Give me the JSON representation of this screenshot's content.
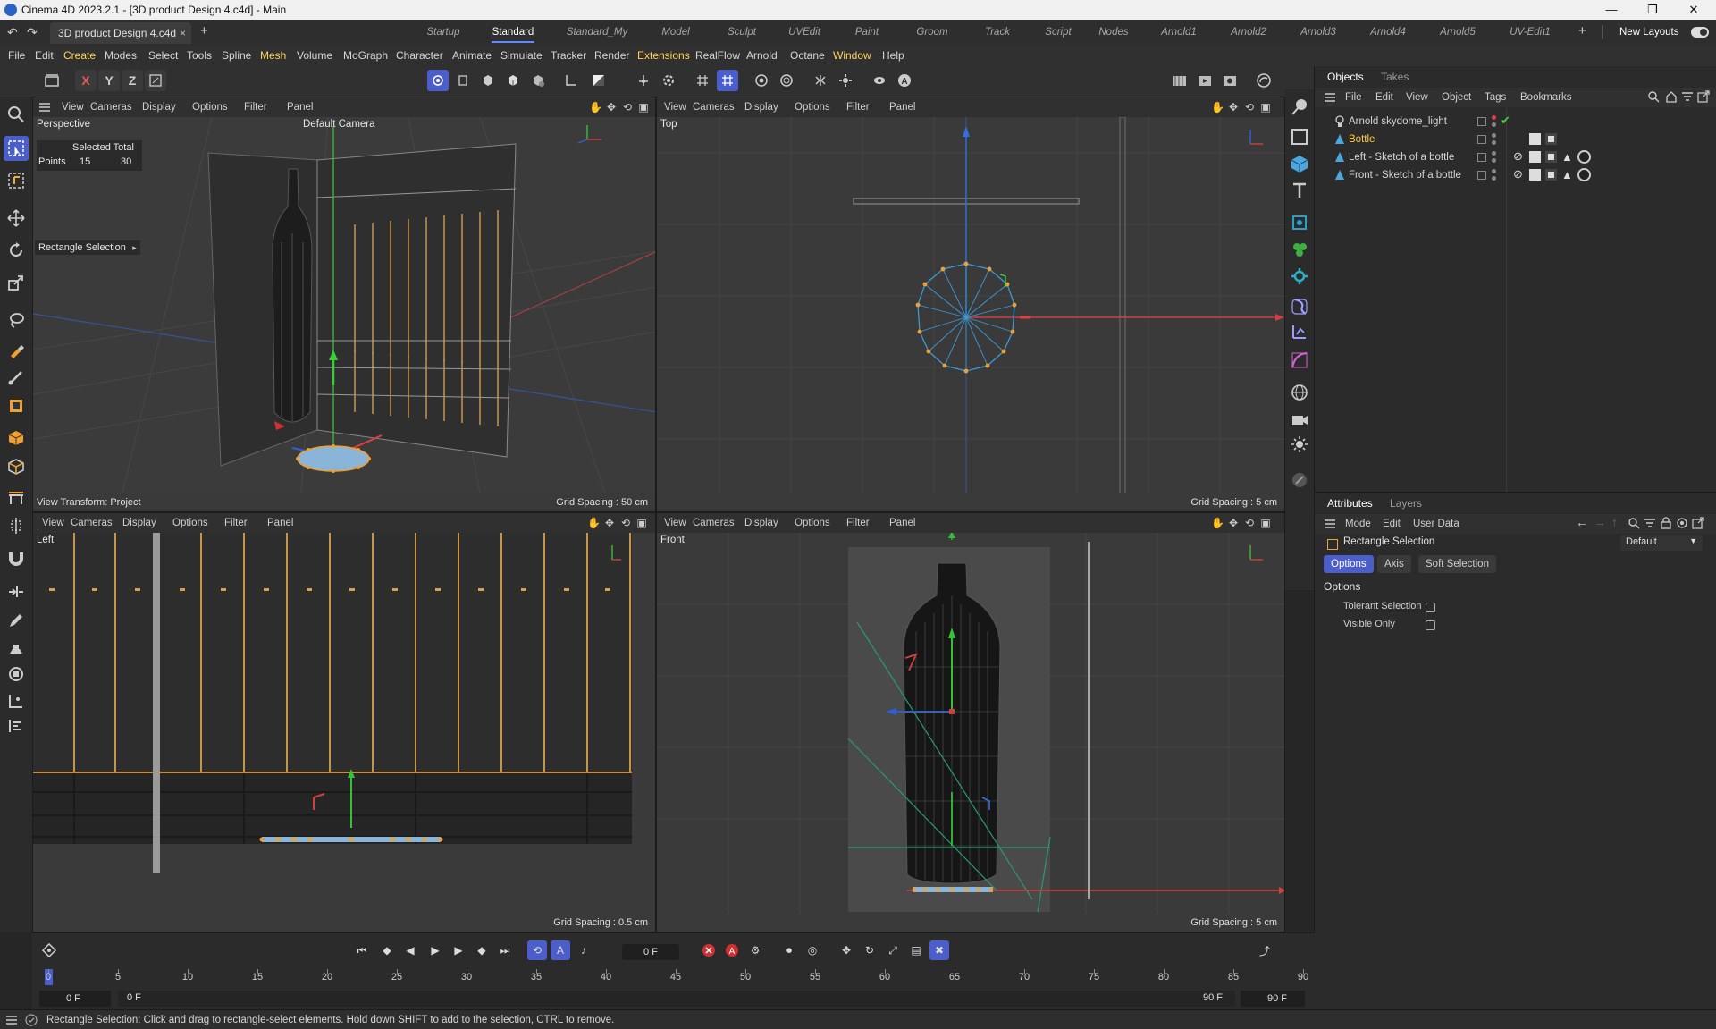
{
  "window": {
    "title": "Cinema 4D 2023.2.1 - [3D product Design 4.c4d] - Main",
    "minimize": "—",
    "maximize": "❐",
    "close": "✕"
  },
  "tabbar": {
    "document_tab": "3D product Design 4.c4d",
    "close_glyph": "×",
    "add_glyph": "+",
    "layouts": [
      "Startup",
      "Standard",
      "Standard_My",
      "Model",
      "Sculpt",
      "UVEdit",
      "Paint",
      "Groom",
      "Track",
      "Script",
      "Nodes",
      "Arnold1",
      "Arnold2",
      "Arnold3",
      "Arnold4",
      "Arnold5",
      "UV-Edit1"
    ],
    "active_layout": "Standard",
    "new_layouts": "New Layouts"
  },
  "menubar": {
    "items": [
      "File",
      "Edit",
      "Create",
      "Modes",
      "Select",
      "Tools",
      "Spline",
      "Mesh",
      "Volume",
      "MoGraph",
      "Character",
      "Animate",
      "Simulate",
      "Tracker",
      "Render",
      "Extensions",
      "RealFlow",
      "Arnold",
      "Octane",
      "Window",
      "Help"
    ],
    "highlighted": [
      "Create",
      "Mesh",
      "Extensions",
      "Window"
    ]
  },
  "toolbar": {
    "axis_x": "X",
    "axis_y": "Y",
    "axis_z": "Z"
  },
  "viewport_menu": [
    "View",
    "Cameras",
    "Display",
    "Options",
    "Filter",
    "Panel"
  ],
  "viewports": {
    "perspective": {
      "name": "Perspective",
      "camera": "Default Camera",
      "grid": "Grid Spacing : 50 cm",
      "view_transform": "View Transform: Project",
      "hud_header": "Selected Total",
      "hud_label": "Points",
      "hud_selected": "15",
      "hud_total": "30",
      "tool_label": "Rectangle Selection"
    },
    "top": {
      "name": "Top",
      "grid": "Grid Spacing : 5 cm"
    },
    "left": {
      "name": "Left",
      "grid": "Grid Spacing : 0.5 cm"
    },
    "front": {
      "name": "Front",
      "grid": "Grid Spacing : 5 cm"
    }
  },
  "objects": {
    "tabs": [
      "Objects",
      "Takes"
    ],
    "menu": [
      "File",
      "Edit",
      "View",
      "Object",
      "Tags",
      "Bookmarks"
    ],
    "rows": [
      {
        "name": "Arnold skydome_light",
        "selected": false
      },
      {
        "name": "Bottle",
        "selected": true
      },
      {
        "name": "Left - Sketch of a bottle",
        "selected": false
      },
      {
        "name": "Front - Sketch of a bottle",
        "selected": false
      }
    ]
  },
  "attributes": {
    "tabs": [
      "Attributes",
      "Layers"
    ],
    "menu": [
      "Mode",
      "Edit",
      "User Data"
    ],
    "tool_name": "Rectangle Selection",
    "preset": "Default",
    "subtabs": [
      "Options",
      "Axis",
      "Soft Selection"
    ],
    "section": "Options",
    "tolerant_selection": "Tolerant Selection",
    "visible_only": "Visible Only"
  },
  "timeline": {
    "current_frame": "0 F",
    "ruler": [
      "0",
      "5",
      "10",
      "15",
      "20",
      "25",
      "30",
      "35",
      "40",
      "45",
      "50",
      "55",
      "60",
      "65",
      "70",
      "75",
      "80",
      "85",
      "90"
    ],
    "start": "0 F",
    "range_start": "0 F",
    "range_end": "90 F",
    "end": "90 F"
  },
  "status": {
    "message": "Rectangle Selection: Click and drag to rectangle-select elements. Hold down SHIFT to add to the selection, CTRL to remove."
  },
  "colors": {
    "accent": "#4c5ec9",
    "selection": "#ffcc3f",
    "axis_x": "#e05050",
    "axis_y": "#40c040",
    "axis_z": "#4a7cff",
    "wire": "#f0a030"
  }
}
